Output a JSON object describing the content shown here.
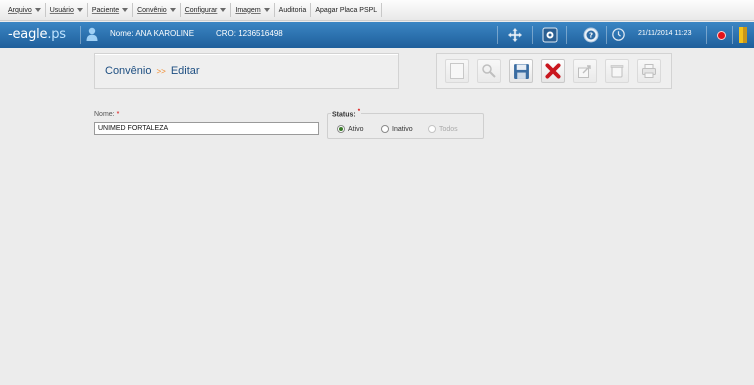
{
  "menu": [
    {
      "label": "Arquivo",
      "arrow": true
    },
    {
      "label": "Usuário",
      "arrow": true
    },
    {
      "label": "Paciente",
      "arrow": true
    },
    {
      "label": "Convênio",
      "arrow": true
    },
    {
      "label": "Configurar",
      "arrow": true
    },
    {
      "label": "Imagem",
      "arrow": true
    },
    {
      "label": "Auditoria",
      "arrow": false
    },
    {
      "label": "Apagar Placa PSPL",
      "arrow": false
    }
  ],
  "header": {
    "logo_main": "eagle",
    "logo_ext": ".ps",
    "user_name": "Nome: ANA KAROLINE",
    "cro": "CRO: 1236516498",
    "datetime": "21/11/2014 11:23",
    "status_color": "#e3121a",
    "accent_color": "#2a6fb0"
  },
  "breadcrumb": {
    "section": "Convênio",
    "separator": ">>",
    "action": "Editar"
  },
  "toolbar": {
    "buttons": [
      {
        "name": "new-button",
        "icon": "blank-page-icon",
        "enabled": false
      },
      {
        "name": "search-button",
        "icon": "magnifier-icon",
        "enabled": false
      },
      {
        "name": "save-button",
        "icon": "floppy-disk-icon",
        "enabled": true
      },
      {
        "name": "cancel-button",
        "icon": "red-x-icon",
        "enabled": true
      },
      {
        "name": "edit-button",
        "icon": "edit-export-icon",
        "enabled": false
      },
      {
        "name": "delete-button",
        "icon": "trash-icon",
        "enabled": false
      },
      {
        "name": "print-button",
        "icon": "printer-icon",
        "enabled": false
      }
    ]
  },
  "form": {
    "name_label": "Nome:",
    "name_required": "*",
    "name_value": "UNIMED FORTALEZA",
    "status_label": "Status:",
    "status_required": "*",
    "status_options": [
      {
        "label": "Ativo",
        "checked": true,
        "enabled": true
      },
      {
        "label": "Inativo",
        "checked": false,
        "enabled": true
      },
      {
        "label": "Todos",
        "checked": false,
        "enabled": false
      }
    ]
  }
}
